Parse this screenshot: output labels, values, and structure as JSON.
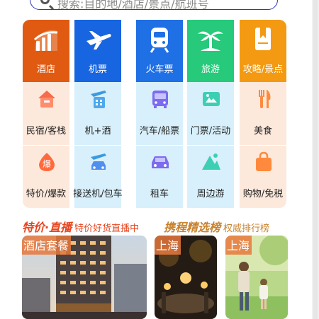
{
  "search": {
    "placeholder": "搜索:目的地/酒店/景点/航班号"
  },
  "colors": {
    "hotel": "#e05a12",
    "flight": "#1765e0",
    "train": "#1f6fe5",
    "travel": "#27c97a",
    "guide": "#f39a12",
    "warm_bg": "#fde9dc",
    "cool_bg": "#d8f0fb"
  },
  "grid": {
    "columns": [
      {
        "top": {
          "label": "酒店",
          "icon": "hotel-chart-icon"
        },
        "cells": [
          {
            "label": "民宿/客栈",
            "icon": "house-icon"
          },
          {
            "label": "特价/爆款",
            "icon": "fire-badge-icon"
          }
        ]
      },
      {
        "top": {
          "label": "机票",
          "icon": "airplane-icon"
        },
        "cells": [
          {
            "label": "机+酒",
            "icon": "plane-hotel-icon"
          },
          {
            "label": "接送机/包车",
            "icon": "plane-car-icon"
          }
        ]
      },
      {
        "top": {
          "label": "火车票",
          "icon": "train-icon"
        },
        "cells": [
          {
            "label": "汽车/船票",
            "icon": "bus-icon"
          },
          {
            "label": "租车",
            "icon": "car-icon"
          }
        ]
      },
      {
        "top": {
          "label": "旅游",
          "icon": "palm-tree-icon"
        },
        "cells": [
          {
            "label": "门票/活动",
            "icon": "ticket-icon"
          },
          {
            "label": "周边游",
            "icon": "mountain-icon"
          }
        ]
      },
      {
        "top": {
          "label": "攻略/景点",
          "icon": "bookmark-book-icon"
        },
        "cells": [
          {
            "label": "美食",
            "icon": "fork-knife-icon"
          },
          {
            "label": "购物/免税",
            "icon": "shopping-bag-icon"
          }
        ]
      }
    ]
  },
  "promo_left": {
    "tag": "特价·直播",
    "subtitle": "特价好货直播中",
    "card_badge": "酒店套餐"
  },
  "promo_right": {
    "tag": "携程精选榜",
    "subtitle": "权威排行榜",
    "card1_badge": "上海",
    "card2_badge": "上海"
  }
}
